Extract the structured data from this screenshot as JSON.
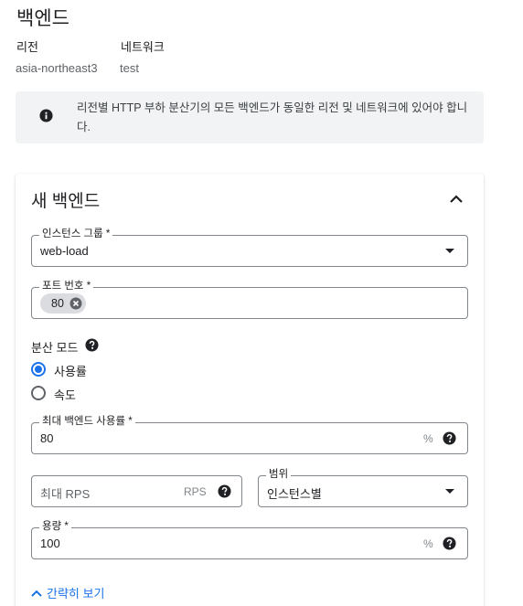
{
  "header": {
    "title": "백엔드",
    "region_label": "리전",
    "region_value": "asia-northeast3",
    "network_label": "네트워크",
    "network_value": "test"
  },
  "info_banner": {
    "icon": "info-icon",
    "text": "리전별 HTTP 부하 분산기의 모든 백엔드가 동일한 리전 및 네트워크에 있어야 합니다."
  },
  "backend_card": {
    "title": "새 백엔드",
    "collapse_icon": "chevron-up-icon",
    "instance_group": {
      "label": "인스턴스 그룹 *",
      "value": "web-load"
    },
    "port_numbers": {
      "label": "포트 번호 *",
      "chips": [
        "80"
      ]
    },
    "balancing_mode": {
      "label": "분산 모드",
      "options": [
        "사용률",
        "속도"
      ],
      "selected": "사용률"
    },
    "max_backend_utilization": {
      "label": "최대 백엔드 사용률 *",
      "value": "80",
      "unit": "%"
    },
    "max_rps": {
      "placeholder": "최대 RPS",
      "unit": "RPS"
    },
    "scope": {
      "label": "범위",
      "value": "인스턴스별"
    },
    "capacity": {
      "label": "용량 *",
      "value": "100",
      "unit": "%"
    },
    "simple_view_link": "간략히 보기"
  },
  "colors": {
    "accent": "#1a73e8",
    "banner_bg": "#f1f3f4",
    "chip_bg": "#dadce0",
    "text": "#202124",
    "muted": "#5f6368"
  }
}
